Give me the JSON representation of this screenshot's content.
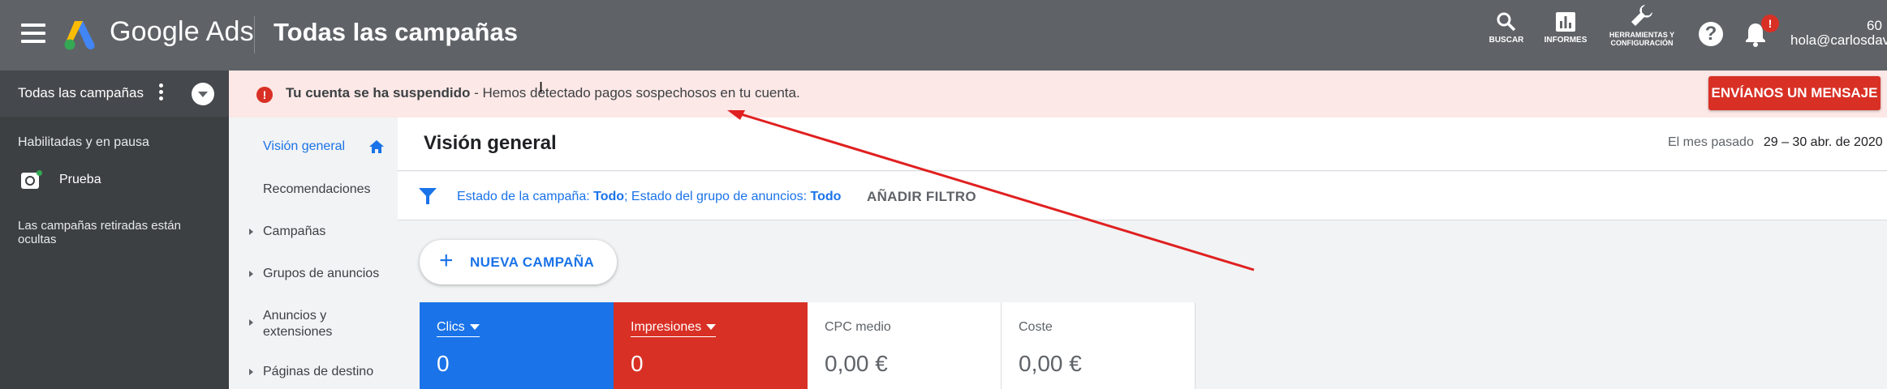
{
  "topbar": {
    "brand": "Google Ads",
    "page_title": "Todas las campañas",
    "tools": [
      {
        "icon": "search-icon",
        "label": "BUSCAR"
      },
      {
        "icon": "bar-chart-icon",
        "label": "INFORMES"
      },
      {
        "icon": "wrench-icon",
        "label": "HERRAMIENTAS Y CONFIGURACIÓN"
      }
    ],
    "help_icon": "help-icon",
    "notifications_badge": "!",
    "account_number": "60",
    "account_email": "hola@carlosdavi"
  },
  "left_sidebar": {
    "header": "Todas las campañas",
    "section_label": "Habilitadas y en pausa",
    "campaign": "Prueba",
    "note": "Las campañas retiradas están ocultas"
  },
  "nav": {
    "items": [
      {
        "label": "Visión general",
        "active": true
      },
      {
        "label": "Recomendaciones"
      },
      {
        "label": "Campañas"
      },
      {
        "label": "Grupos de anuncios"
      },
      {
        "label": "Anuncios y extensiones"
      },
      {
        "label": "Páginas de destino"
      }
    ]
  },
  "alert": {
    "title": "Tu cuenta se ha suspendido",
    "message": " - Hemos detectado pagos sospechosos en tu cuenta.",
    "button": "ENVÍANOS UN MENSAJE"
  },
  "main": {
    "title": "Visión general",
    "date_label": "El mes pasado",
    "date_value": "29 – 30 abr. de 2020",
    "filter": {
      "campaign_status_label": "Estado de la campaña: ",
      "campaign_status_value": "Todo",
      "adgroup_status_label": "; Estado del grupo de anuncios: ",
      "adgroup_status_value": "Todo",
      "add_filter": "AÑADIR FILTRO"
    },
    "new_campaign": "NUEVA CAMPAÑA",
    "metrics": [
      {
        "label": "Clics",
        "value": "0",
        "color": "#1a73e8"
      },
      {
        "label": "Impresiones",
        "value": "0",
        "color": "#d93025"
      },
      {
        "label": "CPC medio",
        "value": "0,00 €"
      },
      {
        "label": "Coste",
        "value": "0,00 €"
      }
    ]
  },
  "colors": {
    "topbar": "#5f6368",
    "sidebar": "#3c4043",
    "accent": "#1a73e8",
    "alert": "#d93025",
    "alert_bg": "#fce8e6"
  }
}
